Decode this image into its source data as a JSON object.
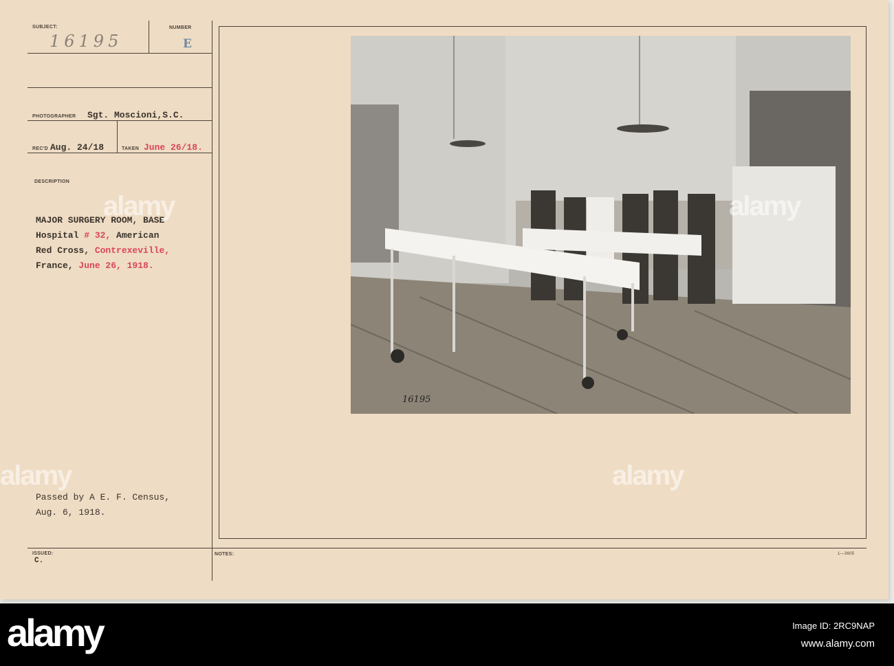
{
  "card": {
    "subject_label": "SUBJECT:",
    "subject_value": "16195",
    "number_label": "NUMBER",
    "number_value": "E",
    "photographer_label": "PHOTOGRAPHER",
    "photographer_value": "Sgt. Moscioni,S.C.",
    "recd_label": "REC'D",
    "recd_value": "Aug. 24/18",
    "taken_label": "TAKEN",
    "taken_value": "June 26/18.",
    "description_label": "DESCRIPTION",
    "description": {
      "l1": "MAJOR SURGERY ROOM, BASE",
      "l2a": "Hospital ",
      "l2b": "# 32,",
      "l2c": " American",
      "l3a": "Red Cross, ",
      "l3b": "Contrexeville,",
      "l4a": "France, ",
      "l4b": "June 26, 1918."
    },
    "censor_l1": "Passed by A E. F. Census,",
    "censor_l2": "Aug. 6, 1918.",
    "issued_label": "ISSUED:",
    "issued_value": "C.",
    "notes_label": "NOTES:",
    "form_number": "1—3605",
    "photo_number": "16195"
  },
  "footer": {
    "logo": "alamy",
    "image_id": "Image ID: 2RC9NAP",
    "url": "www.alamy.com"
  },
  "watermark": "alamy",
  "colors": {
    "paper": "#efdcc4",
    "typed_red": "#d8465a",
    "ink": "#3a332b"
  }
}
